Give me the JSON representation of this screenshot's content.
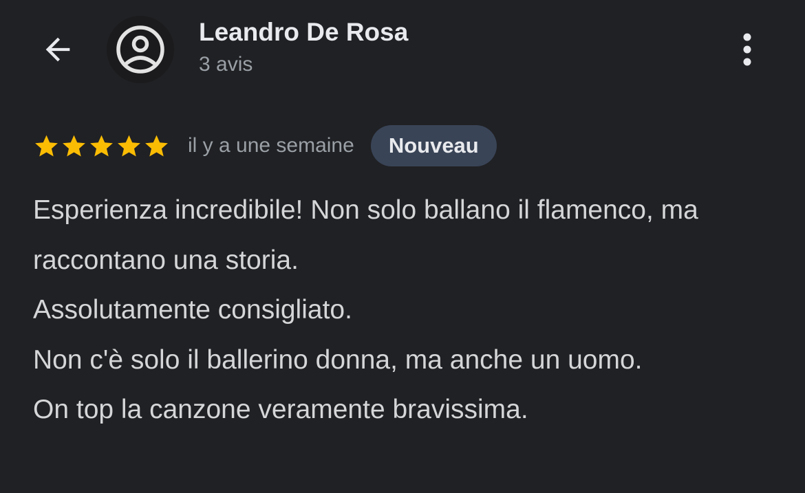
{
  "header": {
    "back_icon": "arrow-left-icon",
    "avatar_icon": "account-circle-icon",
    "reviewer_name": "Leandro De Rosa",
    "review_count": "3 avis",
    "more_icon": "more-vert-icon"
  },
  "review": {
    "rating": 5,
    "rating_max": 5,
    "star_color": "#fbbc04",
    "date": "il y a une semaine",
    "badge": "Nouveau",
    "badge_color": "#394457",
    "paragraphs": [
      "Esperienza incredibile! Non solo ballano il flamenco, ma raccontano una storia.",
      "Assolutamente consigliato.",
      "Non c'è solo il ballerino donna, ma anche un uomo.",
      "On top la canzone veramente bravissima."
    ]
  },
  "colors": {
    "background": "#202124",
    "primary_text": "#e8eaed",
    "secondary_text": "#9aa0a6"
  }
}
